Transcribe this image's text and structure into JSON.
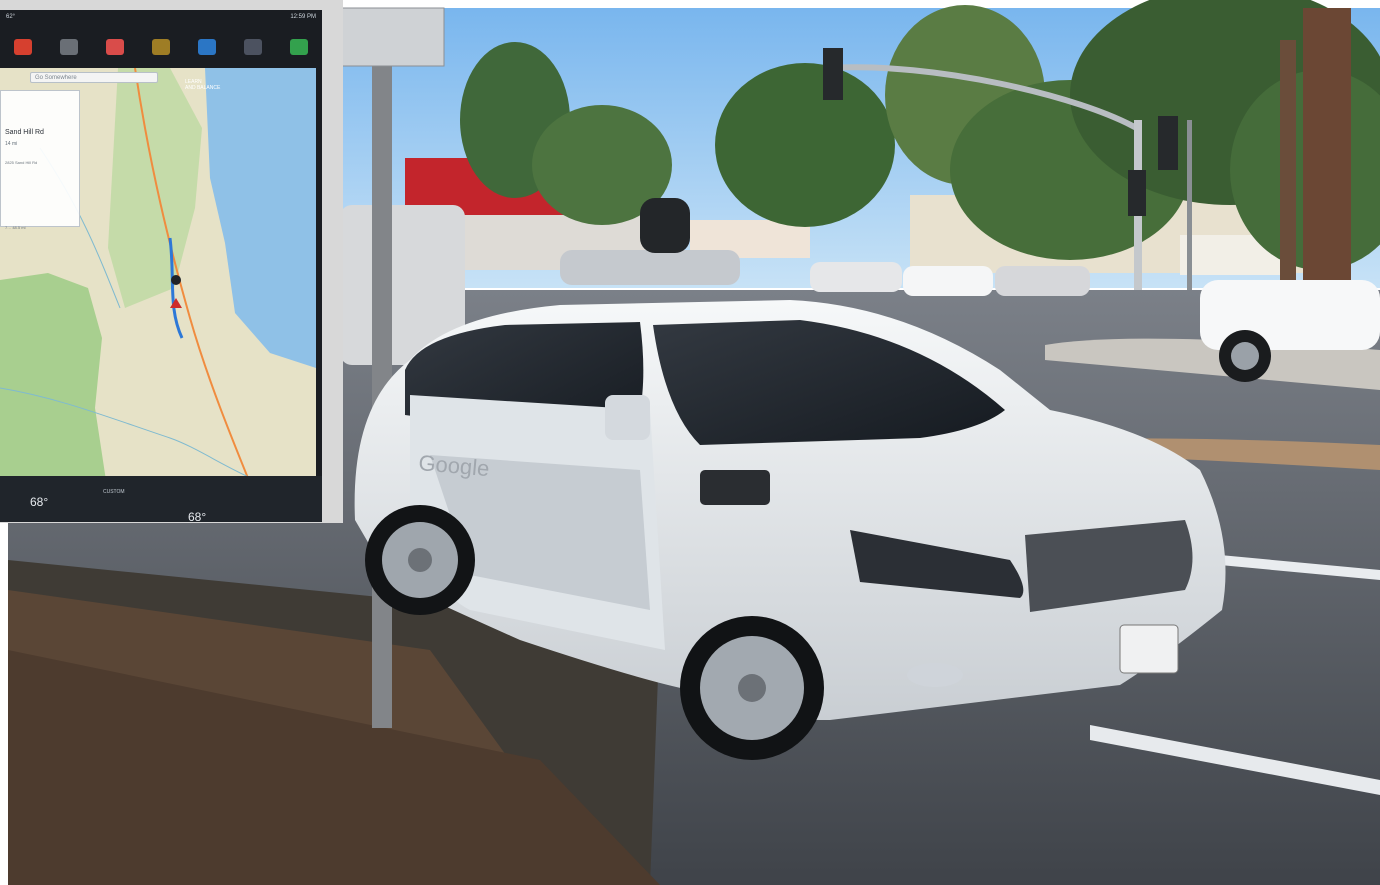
{
  "tablet": {
    "status": {
      "temperature": "62°",
      "time": "12:59 PM"
    },
    "map": {
      "search_placeholder": "Go Somewhere",
      "location_label_line1": "LEARN",
      "location_label_line2": "AND BALANCE",
      "destination_name": "Sand Hill Rd",
      "destination_distance": "14 mi",
      "destination_address": "2825 Sand Hill Rd",
      "route_meta": "7… 48.5 mi"
    },
    "climate": {
      "driver_temp": "68°",
      "passenger_temp": "68°",
      "mode": "CUSTOM"
    }
  },
  "car": {
    "brand_text": "Google"
  },
  "colors": {
    "sky": "#8fc2ef",
    "car_body": "#e9ecef",
    "road": "#555a61",
    "map_land": "#e6e2c7",
    "map_water": "#8fc1e7",
    "map_parks": "#a8cf8f"
  }
}
